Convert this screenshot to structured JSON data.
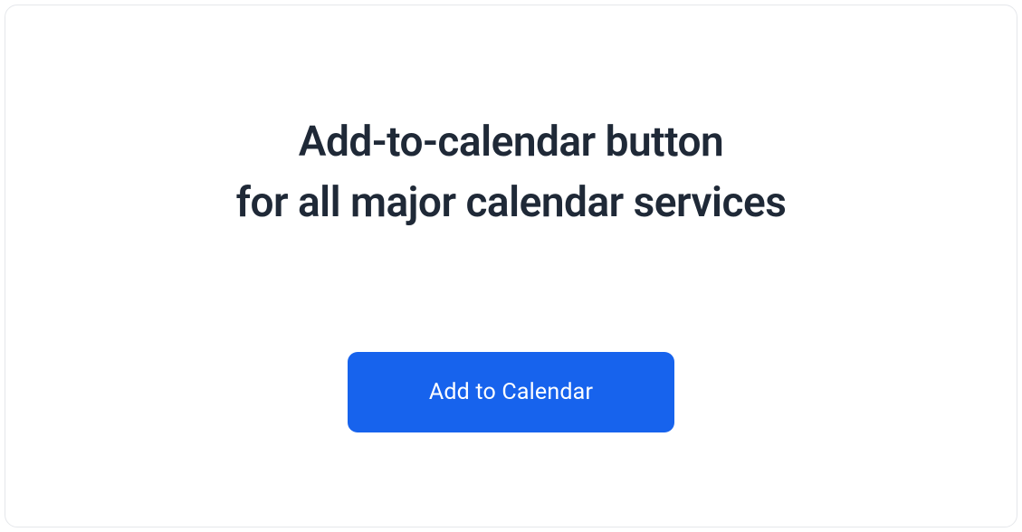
{
  "heading": {
    "line1": "Add-to-calendar button",
    "line2": "for all major calendar services"
  },
  "cta": {
    "label": "Add to Calendar"
  }
}
